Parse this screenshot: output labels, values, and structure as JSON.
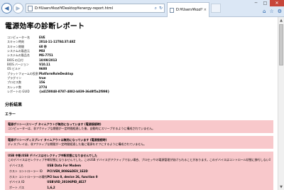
{
  "browser": {
    "address": "D:¥Users¥kozl¥Desktop¥energy-report.html",
    "tab_label": "D:¥Users¥kozl¥Deskto...",
    "tab_close": "×",
    "back_glyph": "◀",
    "forward_glyph": "▶",
    "minimize_glyph": "─",
    "maximize_glyph": "□",
    "close_glyph": "✕",
    "tool_glyphs": {
      "home": "⌂",
      "favorites": "☆",
      "settings": "⚙"
    },
    "addr_tools": {
      "search": "⌕",
      "refresh": "↻"
    }
  },
  "report": {
    "title": "電源効率の診断レポート",
    "info_rows": [
      {
        "key": "コンピューター名",
        "value": "EVE"
      },
      {
        "key": "スキャン時刻",
        "value": "2014-11-11T04:37:48Z"
      },
      {
        "key": "スキャン期間",
        "value": "60 秒"
      },
      {
        "key": "システムの製造元",
        "value": "MSI"
      },
      {
        "key": "システムの製品名",
        "value": "MS-7751"
      },
      {
        "key": "BIOS の日付",
        "value": "10/09/2013"
      },
      {
        "key": "BIOS バージョン",
        "value": "V10.11"
      },
      {
        "key": "OS ビルド",
        "value": "9600"
      },
      {
        "key": "プラットフォームの役割",
        "value": "PlatformRoleDesktop"
      },
      {
        "key": "プラグイン",
        "value": "true"
      },
      {
        "key": "プロセス数",
        "value": "156"
      },
      {
        "key": "スレッド数",
        "value": "2774"
      },
      {
        "key": "レポートの GUID",
        "value": "{a4150048-8787-4882-b839-36d8f5a2f898}"
      }
    ],
    "analysis_title": "分析結果",
    "errors_title": "エラー",
    "errors": [
      {
        "title": "電源ポリシー:スリープ タイムアウトが無効になっています (電源接続時)",
        "desc": "コンピューターは、非アクティブな期間が一定時間経過した後、自動的にスリープするように構成されていません。"
      },
      {
        "title": "電源ポリシー:ディスプレイ タイムアウトは無効になっています (電源接続時)",
        "desc": "ディスプレイは、非アクティブな期間が一定時間経過した後に電源をオフにするように構成されていません。"
      },
      {
        "title": "USB 中断:USB デバイスはセレクティブ中断状態になりませんでした",
        "desc": "このデバイスはセレクティブ中断状態になりませんでした。このUSB デバイスがアクティブでない場合、プロセッサの電源管理が妨げられることがあります。このデバイスはコントロール状態に移行しない可能性があります。"
      }
    ],
    "usb_device": [
      {
        "key": "デバイス名",
        "value": "USB Data For Modem"
      },
      {
        "key": "ホスト コントローラー ID",
        "value": "PCI\\VEN_8086&DEV_1E2D"
      },
      {
        "key": "ホスト コントローラーの場所",
        "value": "PCI bus 0, device 26, function 0"
      },
      {
        "key": "デバイス ID",
        "value": "USB\\VID_20196PID_4E27"
      },
      {
        "key": "ポート パス",
        "value": "1,6,2"
      }
    ]
  },
  "scrollbar": {
    "up_glyph": "▲",
    "down_glyph": "▼"
  }
}
